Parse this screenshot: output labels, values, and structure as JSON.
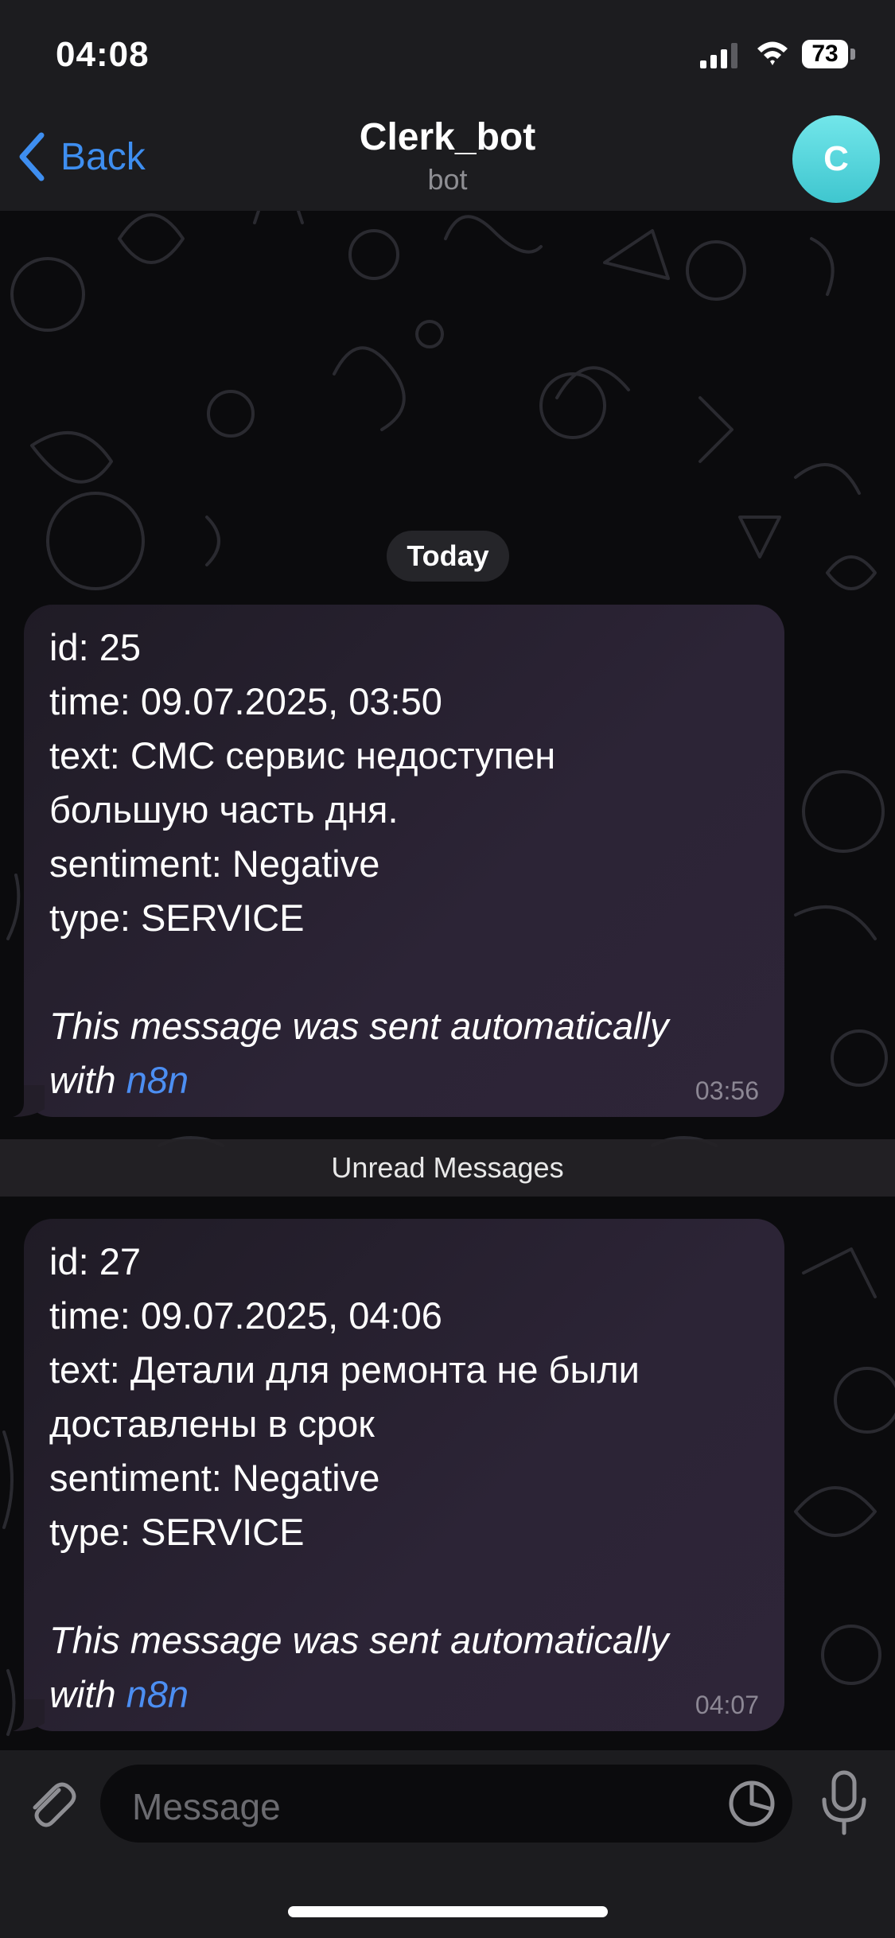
{
  "status_bar": {
    "time": "04:08",
    "battery": "73",
    "icons": [
      "signal-icon",
      "wifi-icon",
      "battery-icon"
    ]
  },
  "header": {
    "back_label": "Back",
    "title": "Clerk_bot",
    "subtitle": "bot",
    "avatar_initial": "C",
    "avatar_color": "#5dd8de",
    "accent_color": "#3e8ef0"
  },
  "date_separator": "Today",
  "unread_label": "Unread Messages",
  "messages": [
    {
      "lines": [
        "id: 25",
        "time: 09.07.2025, 03:50",
        "text: СМС сервис недоступен",
        "большую часть дня.",
        "sentiment: Negative",
        "type: SERVICE"
      ],
      "footer_line1": "This message was sent automatically",
      "footer_with": "with ",
      "footer_link": "n8n",
      "time": "03:56"
    },
    {
      "lines": [
        "id: 27",
        "time: 09.07.2025, 04:06",
        "text: Детали для ремонта не были",
        "доставлены в срок",
        "sentiment: Negative",
        "type: SERVICE"
      ],
      "footer_line1": "This message was sent automatically",
      "footer_with": "with ",
      "footer_link": "n8n",
      "time": "04:07"
    }
  ],
  "composer": {
    "placeholder": "Message",
    "icons": [
      "paperclip-icon",
      "sticker-icon",
      "microphone-icon"
    ]
  }
}
